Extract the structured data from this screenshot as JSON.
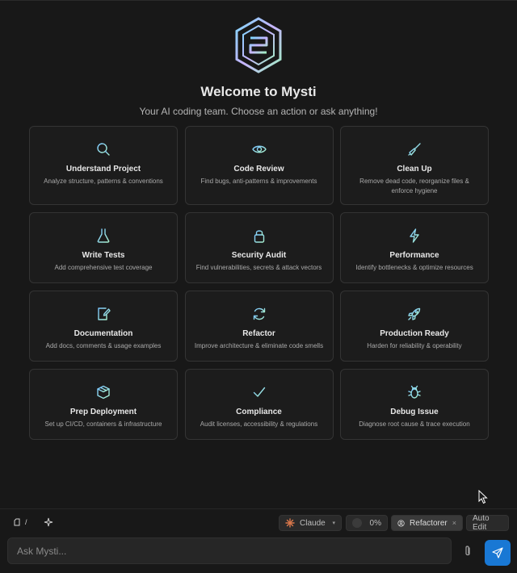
{
  "app": {
    "title": "Welcome to Mysti",
    "subtitle": "Your AI coding team. Choose an action or ask anything!"
  },
  "actions": [
    {
      "icon": "search-icon",
      "title": "Understand Project",
      "desc": "Analyze structure, patterns & conventions"
    },
    {
      "icon": "eye-icon",
      "title": "Code Review",
      "desc": "Find bugs, anti-patterns & improvements"
    },
    {
      "icon": "broom-icon",
      "title": "Clean Up",
      "desc": "Remove dead code, reorganize files & enforce hygiene"
    },
    {
      "icon": "flask-icon",
      "title": "Write Tests",
      "desc": "Add comprehensive test coverage"
    },
    {
      "icon": "lock-icon",
      "title": "Security Audit",
      "desc": "Find vulnerabilities, secrets & attack vectors"
    },
    {
      "icon": "lightning-icon",
      "title": "Performance",
      "desc": "Identify bottlenecks & optimize resources"
    },
    {
      "icon": "document-edit-icon",
      "title": "Documentation",
      "desc": "Add docs, comments & usage examples"
    },
    {
      "icon": "refresh-icon",
      "title": "Refactor",
      "desc": "Improve architecture & eliminate code smells"
    },
    {
      "icon": "rocket-icon",
      "title": "Production Ready",
      "desc": "Harden for reliability & operability"
    },
    {
      "icon": "package-icon",
      "title": "Prep Deployment",
      "desc": "Set up CI/CD, containers & infrastructure"
    },
    {
      "icon": "checkmark-icon",
      "title": "Compliance",
      "desc": "Audit licenses, accessibility & regulations"
    },
    {
      "icon": "bug-icon",
      "title": "Debug Issue",
      "desc": "Diagnose root cause & trace execution"
    }
  ],
  "toolbar": {
    "context_label": "/",
    "model": "Claude",
    "percent": "0%",
    "agent": "Refactorer",
    "agent_close": "×",
    "mode": "Auto Edit"
  },
  "input": {
    "placeholder": "Ask Mysti..."
  },
  "colors": {
    "background": "#181818",
    "card": "#1c1c1c",
    "accent": "#1978d4",
    "icon_gradient": [
      "#8fd3ff",
      "#a9f0d8"
    ]
  }
}
